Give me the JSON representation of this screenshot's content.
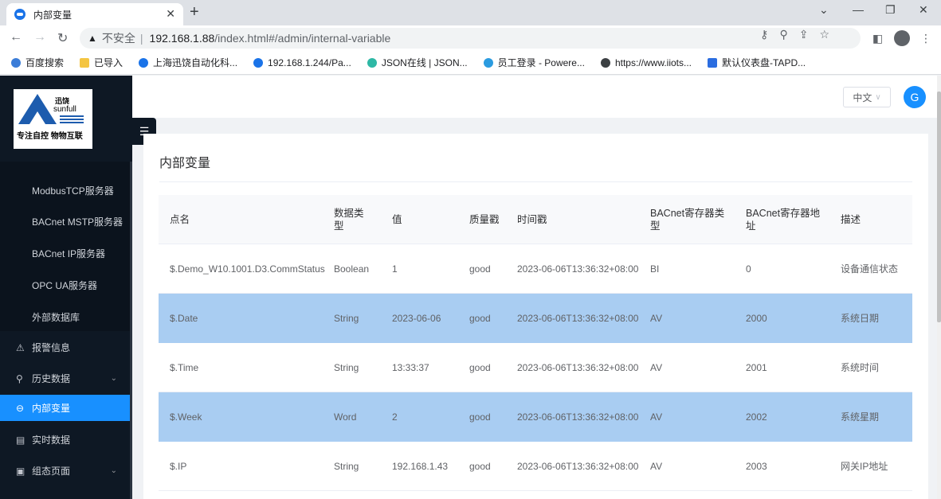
{
  "browser": {
    "tab_title": "内部变量",
    "tab_close": "✕",
    "new_tab": "+",
    "url_warning": "▲",
    "url_insecure": "不安全",
    "url_sep": "|",
    "url_host": "192.168.1.88",
    "url_path": "/index.html#/admin/internal-variable",
    "bookmarks": [
      {
        "label": "百度搜索",
        "color": "#3b7dd8"
      },
      {
        "label": "已导入",
        "color": "#f4c542"
      },
      {
        "label": "上海迅饶自动化科...",
        "color": "#1a73e8"
      },
      {
        "label": "192.168.1.244/Pa...",
        "color": "#1a73e8"
      },
      {
        "label": "JSON在线 | JSON...",
        "color": "#2eb8a5"
      },
      {
        "label": "员工登录 - Powere...",
        "color": "#2b9be0"
      },
      {
        "label": "https://www.iiots...",
        "color": "#3c4043"
      },
      {
        "label": "默认仪表盘-TAPD...",
        "color": "#2b6de0"
      }
    ]
  },
  "app": {
    "logo": {
      "cn": "迅饶",
      "en": "sunfull",
      "slogan": "专注自控 物物互联"
    },
    "menu_toggle": "☰",
    "submenu": [
      "ModbusTCP服务器",
      "BACnet MSTP服务器",
      "BACnet IP服务器",
      "OPC UA服务器",
      "外部数据库"
    ],
    "nav": [
      {
        "icon": "⚠",
        "label": "报警信息",
        "chevron": ""
      },
      {
        "icon": "⚲",
        "label": "历史数据",
        "chevron": "⌄"
      },
      {
        "icon": "⊖",
        "label": "内部变量",
        "chevron": ""
      },
      {
        "icon": "▤",
        "label": "实时数据",
        "chevron": ""
      },
      {
        "icon": "▣",
        "label": "组态页面",
        "chevron": "⌄"
      }
    ],
    "lang_label": "中文",
    "lang_chevron": "∨",
    "user_icon": "G",
    "accent": "#1890ff",
    "row_highlight": "#a9cdf2"
  },
  "page": {
    "title": "内部变量",
    "columns": [
      "点名",
      "数据类型",
      "值",
      "质量戳",
      "时间戳",
      "BACnet寄存器类型",
      "BACnet寄存器地址",
      "描述"
    ],
    "rows": [
      [
        "$.Demo_W10.1001.D3.CommStatus",
        "Boolean",
        "1",
        "good",
        "2023-06-06T13:36:32+08:00",
        "BI",
        "0",
        "设备通信状态"
      ],
      [
        "$.Date",
        "String",
        "2023-06-06",
        "good",
        "2023-06-06T13:36:32+08:00",
        "AV",
        "2000",
        "系统日期"
      ],
      [
        "$.Time",
        "String",
        "13:33:37",
        "good",
        "2023-06-06T13:36:32+08:00",
        "AV",
        "2001",
        "系统时间"
      ],
      [
        "$.Week",
        "Word",
        "2",
        "good",
        "2023-06-06T13:36:32+08:00",
        "AV",
        "2002",
        "系统星期"
      ],
      [
        "$.IP",
        "String",
        "192.168.1.43",
        "good",
        "2023-06-06T13:36:32+08:00",
        "AV",
        "2003",
        "网关IP地址"
      ]
    ]
  }
}
